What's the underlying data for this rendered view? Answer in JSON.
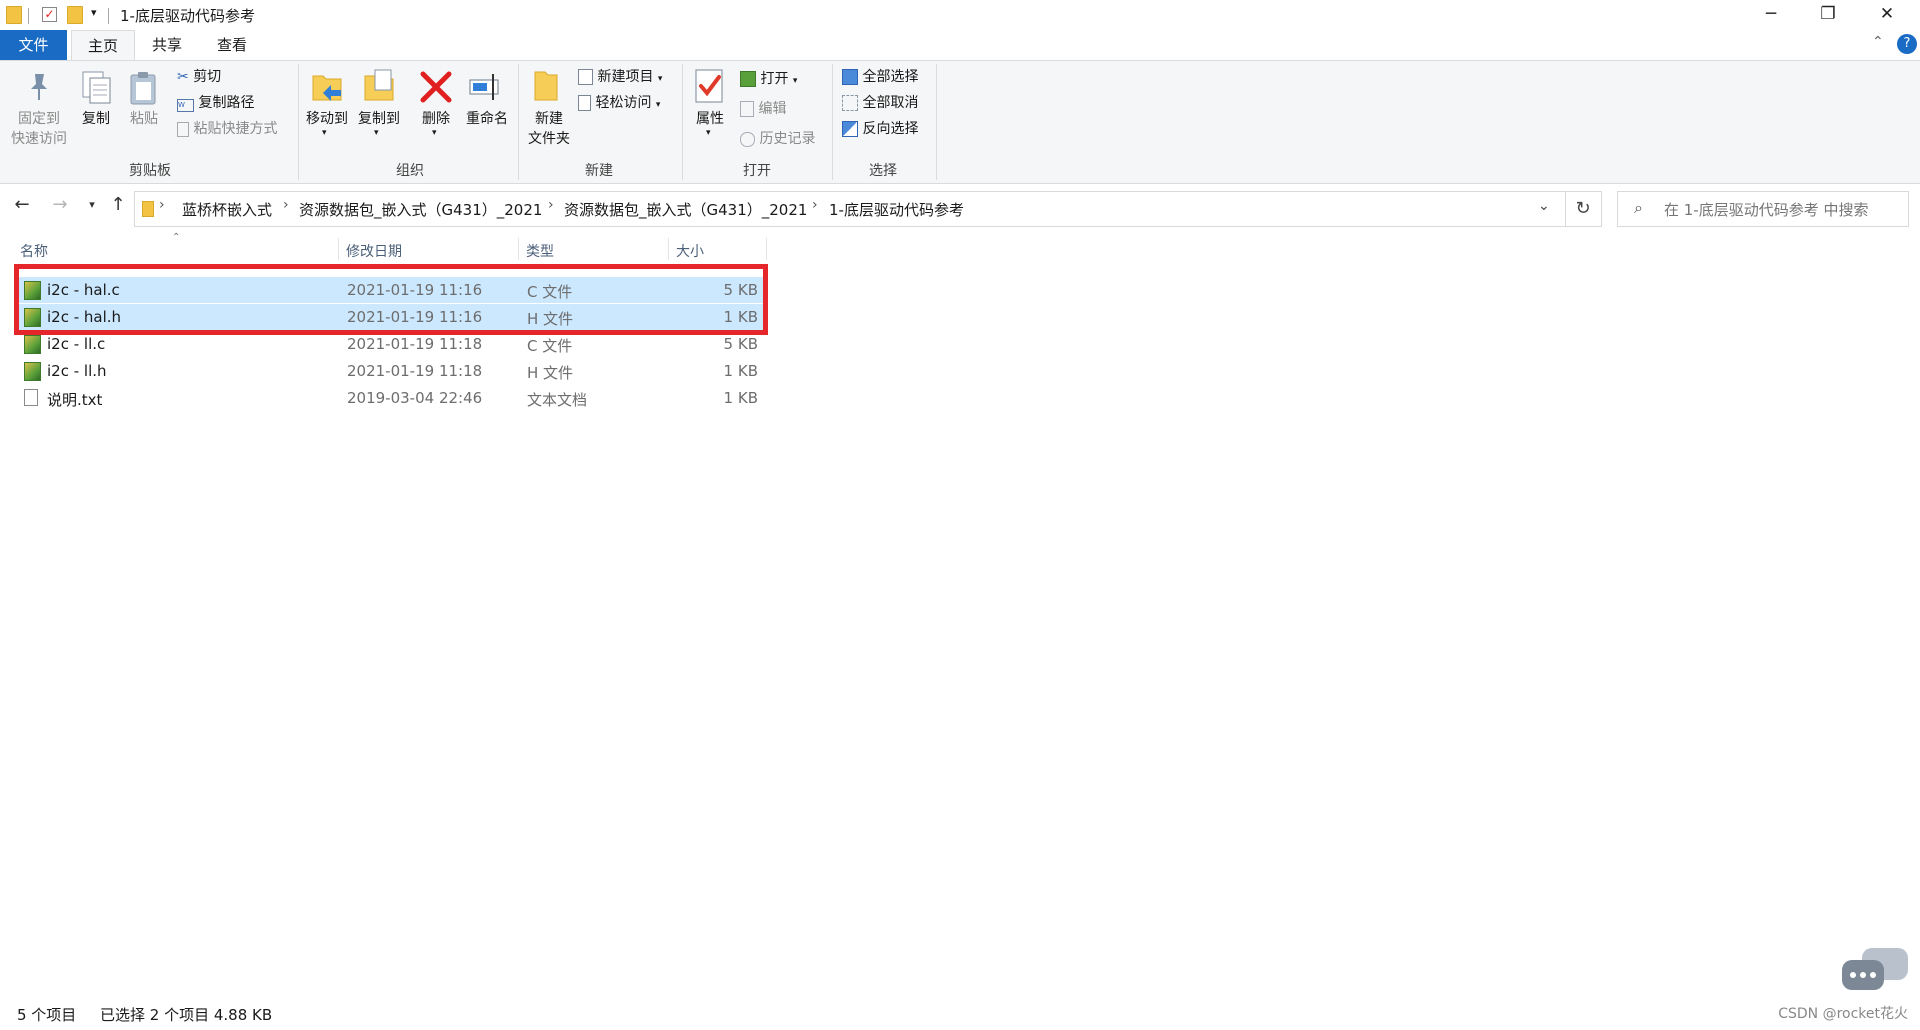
{
  "window": {
    "title": "1-底层驱动代码参考"
  },
  "ribbon": {
    "tabs": [
      "文件",
      "主页",
      "共享",
      "查看"
    ],
    "clipboard": {
      "group_label": "剪贴板",
      "pin_label_1": "固定到",
      "pin_label_2": "快速访问",
      "copy": "复制",
      "paste": "粘贴",
      "cut": "剪切",
      "copy_path": "复制路径",
      "paste_shortcut": "粘贴快捷方式"
    },
    "organize": {
      "group_label": "组织",
      "move_to": "移动到",
      "copy_to": "复制到",
      "delete": "删除",
      "rename": "重命名"
    },
    "new": {
      "group_label": "新建",
      "new_folder_1": "新建",
      "new_folder_2": "文件夹",
      "new_item": "新建项目",
      "easy_access": "轻松访问"
    },
    "open": {
      "group_label": "打开",
      "properties": "属性",
      "open": "打开",
      "edit": "编辑",
      "history": "历史记录"
    },
    "select": {
      "group_label": "选择",
      "select_all": "全部选择",
      "select_none": "全部取消",
      "invert": "反向选择"
    }
  },
  "address": {
    "crumbs": [
      "蓝桥杯嵌入式",
      "资源数据包_嵌入式（G431）_2021",
      "资源数据包_嵌入式（G431）_2021",
      "1-底层驱动代码参考"
    ],
    "search_placeholder": "在 1-底层驱动代码参考 中搜索"
  },
  "columns": {
    "name": "名称",
    "modified": "修改日期",
    "type": "类型",
    "size": "大小"
  },
  "files": [
    {
      "name": "i2c - hal.c",
      "modified": "2021-01-19 11:16",
      "type": "C 文件",
      "size": "5 KB",
      "selected": true,
      "icon": "c-source-file-icon"
    },
    {
      "name": "i2c - hal.h",
      "modified": "2021-01-19 11:16",
      "type": "H 文件",
      "size": "1 KB",
      "selected": true,
      "icon": "header-file-icon"
    },
    {
      "name": "i2c - ll.c",
      "modified": "2021-01-19 11:18",
      "type": "C 文件",
      "size": "5 KB",
      "selected": false,
      "icon": "c-source-file-icon"
    },
    {
      "name": "i2c - ll.h",
      "modified": "2021-01-19 11:18",
      "type": "H 文件",
      "size": "1 KB",
      "selected": false,
      "icon": "header-file-icon"
    },
    {
      "name": "说明.txt",
      "modified": "2019-03-04 22:46",
      "type": "文本文档",
      "size": "1 KB",
      "selected": false,
      "icon": "text-file-icon"
    }
  ],
  "status": {
    "item_count": "5 个项目",
    "selection": "已选择 2 个项目  4.88 KB"
  },
  "watermark": "CSDN @rocket花火",
  "colors": {
    "accent": "#1a6bc4",
    "selection": "#cce8ff",
    "highlight_box": "#e5262b"
  }
}
